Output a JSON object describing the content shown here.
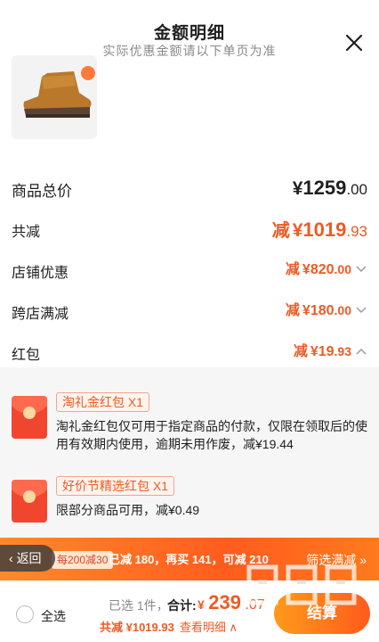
{
  "header": {
    "title": "金额明细",
    "subtitle": "实际优惠金额请以下单页为准"
  },
  "summary": {
    "total": {
      "label": "商品总价",
      "yen": "¥",
      "int": "1259",
      "dec": ".00"
    },
    "reduction": {
      "label": "共减",
      "prefix": "减",
      "yen": "¥",
      "int": "1019",
      "dec": ".93"
    },
    "shop": {
      "label": "店铺优惠",
      "prefix": "减",
      "yen": "¥",
      "int": "820",
      "dec": ".00"
    },
    "cross": {
      "label": "跨店满减",
      "prefix": "减",
      "yen": "¥",
      "int": "180",
      "dec": ".00"
    },
    "redpacket": {
      "label": "红包",
      "prefix": "减",
      "yen": "¥",
      "int": "19",
      "dec": ".93"
    }
  },
  "coupons": [
    {
      "tag": "淘礼金红包 X1",
      "desc": "淘礼金红包仅可用于指定商品的付款，仅限在领取后的使用有效期内使用，逾期未用作废，减¥19.44"
    },
    {
      "tag": "好价节精选红包 X1",
      "desc": "限部分商品可用，减¥0.49"
    }
  ],
  "banner": {
    "back": "返回",
    "chip": "每200减30",
    "text": "已减 180，再买 141，可减 210",
    "link": "筛选满减 »"
  },
  "bottom": {
    "select_all": "全选",
    "selected": "已选 1件，",
    "total_label": "合计:",
    "total_yen": "¥",
    "total_int": "239",
    "total_dec": ".07",
    "disc_prefix": "共减 ¥",
    "disc_value": "1019.93",
    "detail": "查看明细 ∧",
    "checkout": "结算"
  },
  "colors": {
    "accent": "#ef5a24",
    "banner": "#ff6a22"
  },
  "icons": {
    "close": "close-icon",
    "chevron": "chevron-down-icon",
    "chevron_up": "chevron-up-icon"
  }
}
